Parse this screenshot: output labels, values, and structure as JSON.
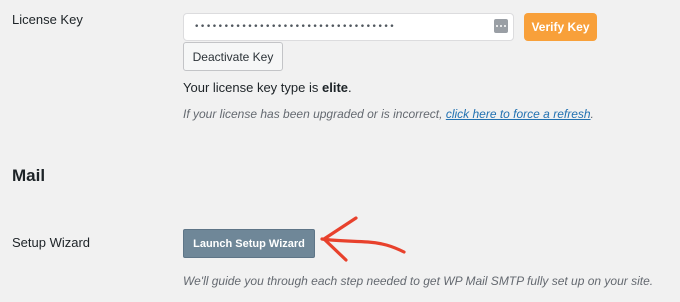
{
  "license": {
    "label": "License Key",
    "input_value": "••••••••••••••••••••••••••••••••••",
    "password_icon": "dots-icon",
    "verify_label": "Verify Key",
    "deactivate_label": "Deactivate Key",
    "type_prefix": "Your license key type is ",
    "type_value": "elite",
    "type_suffix": ".",
    "refresh_prefix": "If your license has been upgraded or is incorrect, ",
    "refresh_link": "click here to force a refresh",
    "refresh_suffix": "."
  },
  "mail": {
    "heading": "Mail"
  },
  "setup_wizard": {
    "label": "Setup Wizard",
    "button_label": "Launch Setup Wizard",
    "description": "We'll guide you through each step needed to get WP Mail SMTP fully set up on your site.",
    "annotation_icon": "arrow-icon"
  },
  "colors": {
    "background": "#f1f1f1",
    "verify_button": "#f8a03a",
    "wizard_button": "#6f8798",
    "link": "#2271b1",
    "annotation_arrow": "#e8412c"
  }
}
